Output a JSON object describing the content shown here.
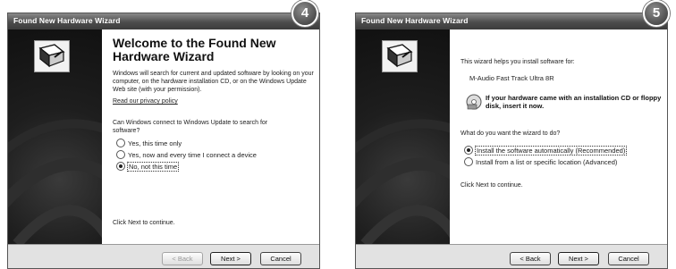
{
  "left": {
    "badge": "4",
    "title": "Found New Hardware Wizard",
    "heading": "Welcome to the Found New Hardware Wizard",
    "intro": "Windows will search for current and updated software by looking on your computer, on the hardware installation CD, or on the Windows Update Web site (with your permission).",
    "privacy_link": "Read our privacy policy",
    "question": "Can Windows connect to Windows Update to search for software?",
    "options": [
      {
        "label": "Yes, this time only",
        "selected": false
      },
      {
        "label": "Yes, now and every time I connect a device",
        "selected": false
      },
      {
        "label": "No, not this time",
        "selected": true
      }
    ],
    "continue_text": "Click Next to continue.",
    "buttons": {
      "back": "< Back",
      "next": "Next >",
      "cancel": "Cancel"
    }
  },
  "right": {
    "badge": "5",
    "title": "Found New Hardware Wizard",
    "helps_text": "This wizard helps you install software for:",
    "device_name": "M-Audio Fast Track Ultra 8R",
    "cd_text": "If your hardware came with an installation CD or floppy disk, insert it now.",
    "question": "What do you want the wizard to do?",
    "options": [
      {
        "label": "Install the software automatically (Recommended)",
        "selected": true
      },
      {
        "label": "Install from a list or specific location (Advanced)",
        "selected": false
      }
    ],
    "continue_text": "Click Next to continue.",
    "buttons": {
      "back": "< Back",
      "next": "Next >",
      "cancel": "Cancel"
    }
  },
  "icons": {
    "hardware": "hardware-install-icon",
    "cd": "cd-disk-icon"
  }
}
